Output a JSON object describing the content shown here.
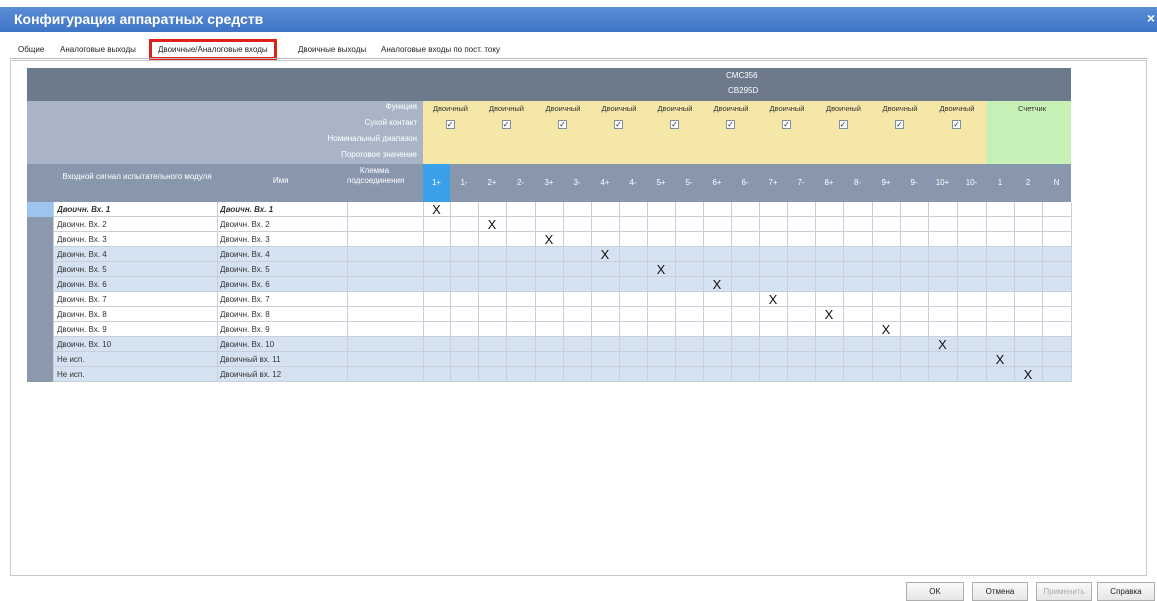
{
  "window": {
    "title": "Конфигурация аппаратных средств",
    "close_glyph": "×"
  },
  "tabs": [
    "Общие",
    "Аналоговые выходы",
    "Двоичные/Аналоговые входы",
    "Двоичные выходы",
    "Аналоговые входы по пост. току"
  ],
  "active_tab": 2,
  "grid": {
    "module_name_1": "CMC356",
    "module_name_2": "CB295D",
    "row_labels": {
      "function": "Функция",
      "dry_contact": "Сухой контакт",
      "nominal_range": "Номинальный диапазон",
      "threshold": "Пороговое значение"
    },
    "function_value": "Двоичный",
    "counter_label": "Счетчик",
    "col_headers": {
      "input_signal": "Входной сигнал испытательного модуля",
      "name": "Имя",
      "terminal": "Клемма подсоединения"
    },
    "binary_cols": [
      "1+",
      "1-",
      "2+",
      "2-",
      "3+",
      "3-",
      "4+",
      "4-",
      "5+",
      "5-",
      "6+",
      "6-",
      "7+",
      "7-",
      "8+",
      "8-",
      "9+",
      "9-",
      "10+",
      "10-"
    ],
    "counter_cols": [
      "1",
      "2",
      "N"
    ],
    "rows": [
      {
        "signal": "Двоичн. Вх. 1",
        "name": "Двоичн. Вх. 1",
        "mark": 0
      },
      {
        "signal": "Двоичн. Вх. 2",
        "name": "Двоичн. Вх. 2",
        "mark": 2
      },
      {
        "signal": "Двоичн. Вх. 3",
        "name": "Двоичн. Вх. 3",
        "mark": 4
      },
      {
        "signal": "Двоичн. Вх. 4",
        "name": "Двоичн. Вх. 4",
        "mark": 6
      },
      {
        "signal": "Двоичн. Вх. 5",
        "name": "Двоичн. Вх. 5",
        "mark": 8
      },
      {
        "signal": "Двоичн. Вх. 6",
        "name": "Двоичн. Вх. 6",
        "mark": 10
      },
      {
        "signal": "Двоичн. Вх. 7",
        "name": "Двоичн. Вх. 7",
        "mark": 12
      },
      {
        "signal": "Двоичн. Вх. 8",
        "name": "Двоичн. Вх. 8",
        "mark": 14
      },
      {
        "signal": "Двоичн. Вх. 9",
        "name": "Двоичн. Вх. 9",
        "mark": 16
      },
      {
        "signal": "Двоичн. Вх. 10",
        "name": "Двоичн. Вх. 10",
        "mark": 18
      },
      {
        "signal": "Не исп.",
        "name": "Двоичный вх. 11",
        "mark": 20
      },
      {
        "signal": "Не исп.",
        "name": "Двоичный вх. 12",
        "mark": 21
      }
    ],
    "mark_glyph": "X",
    "check_glyph": "✓"
  },
  "buttons": {
    "ok": "OK",
    "cancel": "Отмена",
    "apply": "Применить",
    "help": "Справка"
  },
  "colors": {
    "title_bar": "#3e74c4",
    "function_band": "#f5e7a7",
    "counter_band": "#c6f0b5",
    "selected_column": "#3aa0ea",
    "row_alt": "#d4e2f1",
    "tab_highlight": "#e0201c"
  }
}
